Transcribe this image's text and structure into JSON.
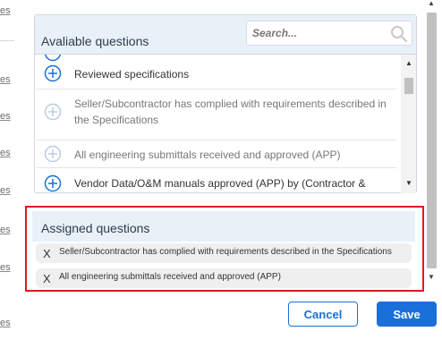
{
  "background": {
    "fragments": [
      "es",
      "es",
      "es",
      "es",
      "es",
      "es",
      "es",
      "es"
    ]
  },
  "available": {
    "title": "Avaliable questions",
    "search": {
      "placeholder": "Search...",
      "value": ""
    },
    "items": [
      {
        "text": "Reviewed specifications",
        "enabled": true
      },
      {
        "text": "Seller/Subcontractor has complied with requirements described in the Specifications",
        "enabled": false
      },
      {
        "text": "All engineering submittals received and approved (APP)",
        "enabled": false
      },
      {
        "text": "Vendor Data/O&M manuals approved (APP) by (Contractor & Owner)",
        "enabled": true
      }
    ]
  },
  "assigned": {
    "title": "Assigned questions",
    "remove_label": "X",
    "items": [
      {
        "text": "Seller/Subcontractor has complied with requirements described in the Specifications"
      },
      {
        "text": "All engineering submittals received and approved (APP)"
      }
    ]
  },
  "buttons": {
    "cancel": "Cancel",
    "save": "Save"
  },
  "colors": {
    "accent": "#1b6fd8",
    "highlight": "#e0191c",
    "header_bg": "#e8f0f8"
  }
}
